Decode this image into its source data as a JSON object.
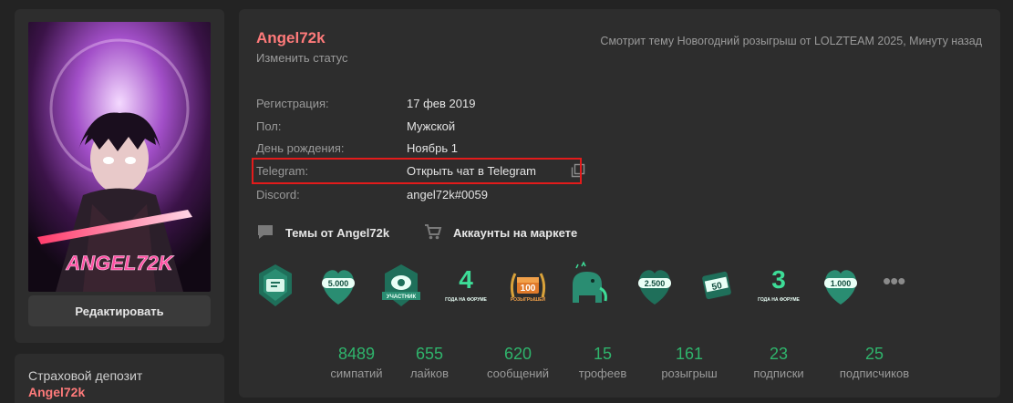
{
  "sidebar": {
    "edit_label": "Редактировать",
    "avatar_text": "ANGEL72K",
    "deposit_title": "Страховой депозит",
    "deposit_user": "Angel72k"
  },
  "profile": {
    "username": "Angel72k",
    "change_status": "Изменить статус",
    "activity": "Смотрит тему Новогодний розыгрыш от LOLZTEAM 2025, Минуту назад",
    "info": [
      {
        "label": "Регистрация:",
        "value": "17 фев 2019"
      },
      {
        "label": "Пол:",
        "value": "Мужской"
      },
      {
        "label": "День рождения:",
        "value": "Ноябрь 1"
      },
      {
        "label": "Telegram:",
        "value": "Открыть чат в Telegram"
      },
      {
        "label": "Discord:",
        "value": "angel72k#0059"
      }
    ],
    "links": {
      "topics": "Темы от Angel72k",
      "market": "Аккаунты на маркете"
    },
    "trophy_texts": [
      "5.000",
      "УЧАСТНИК",
      "4",
      "ГОДА НА ФОРУМЕ",
      "100",
      "РОЗЫГРЫШЕЙ",
      "2.500",
      "50",
      "3",
      "ГОДА НА ФОРУМЕ",
      "1.000"
    ],
    "stats": [
      {
        "value": "8489",
        "label": "симпатий"
      },
      {
        "value": "655",
        "label": "лайков"
      },
      {
        "value": "620",
        "label": "сообщений"
      },
      {
        "value": "15",
        "label": "трофеев"
      },
      {
        "value": "161",
        "label": "розыгрыш"
      },
      {
        "value": "23",
        "label": "подписки"
      },
      {
        "value": "25",
        "label": "подписчиков"
      }
    ]
  },
  "colors": {
    "username": "#fe7a7a",
    "stat_value": "#2fb46c",
    "highlight": "#e31b1b",
    "card_bg": "#2d2d2d",
    "page_bg": "#232323"
  }
}
